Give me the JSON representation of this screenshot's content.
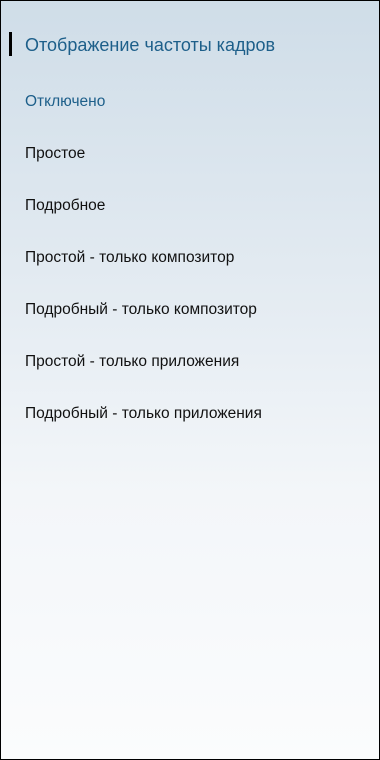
{
  "header": {
    "title": "Отображение частоты кадров"
  },
  "options": [
    {
      "label": "Отключено",
      "selected": true
    },
    {
      "label": "Простое",
      "selected": false
    },
    {
      "label": "Подробное",
      "selected": false
    },
    {
      "label": "Простой - только композитор",
      "selected": false
    },
    {
      "label": "Подробный - только композитор",
      "selected": false
    },
    {
      "label": "Простой - только приложения",
      "selected": false
    },
    {
      "label": "Подробный - только приложения",
      "selected": false
    }
  ],
  "colors": {
    "accent": "#1d5f8a",
    "text": "#111111",
    "background_top": "#cfdde8",
    "background_bottom": "#fbfcfd"
  }
}
